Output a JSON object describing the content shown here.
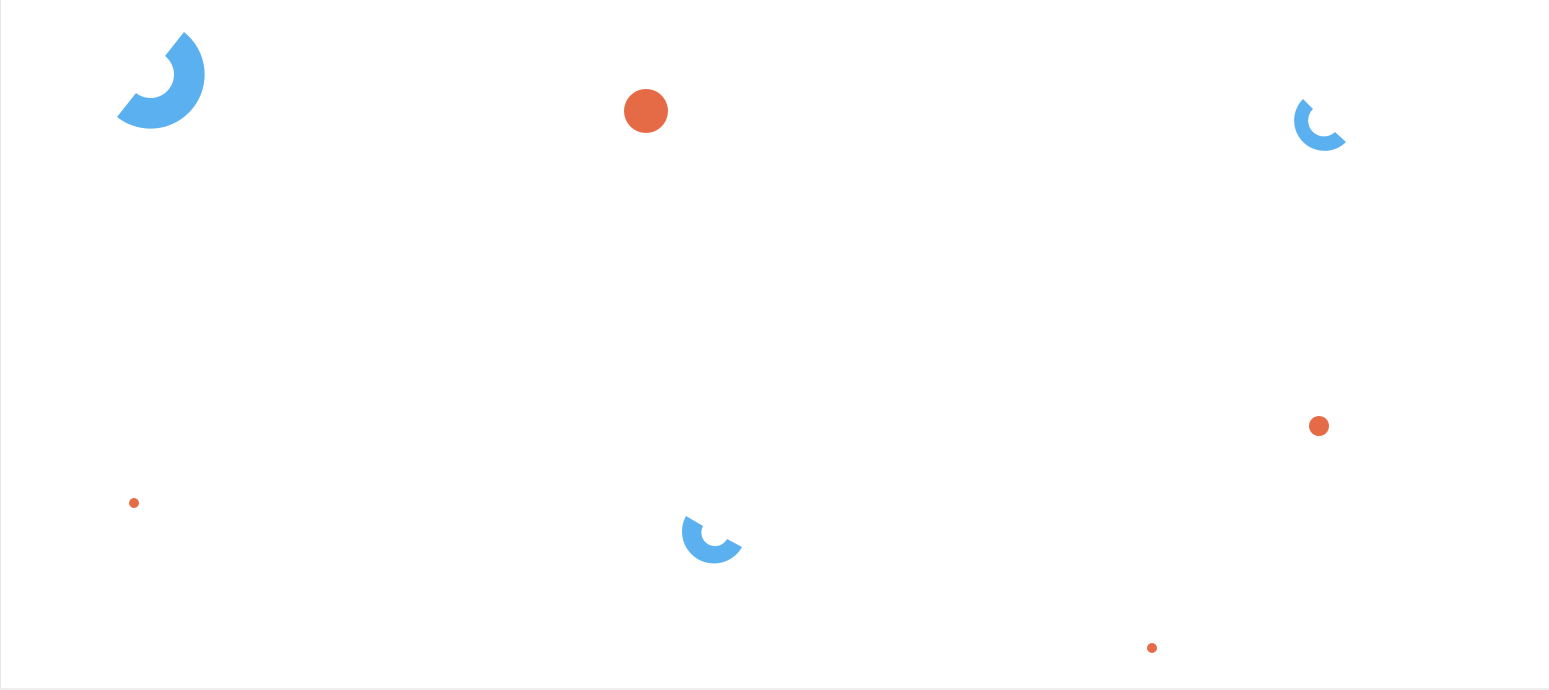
{
  "colors": {
    "background": "#ffffff",
    "arc_blue": "#5bb1f0",
    "dot_orange": "#e56b47"
  },
  "shapes": {
    "arcs": [
      {
        "name": "large-blue-arc-decoration"
      },
      {
        "name": "small-blue-arc-decoration-top-right"
      },
      {
        "name": "small-blue-arc-decoration-bottom-center"
      }
    ],
    "dots": [
      {
        "name": "large-orange-dot-decoration"
      },
      {
        "name": "medium-orange-dot-decoration"
      },
      {
        "name": "tiny-orange-dot-decoration-left"
      },
      {
        "name": "tiny-orange-dot-decoration-bottom"
      }
    ]
  }
}
